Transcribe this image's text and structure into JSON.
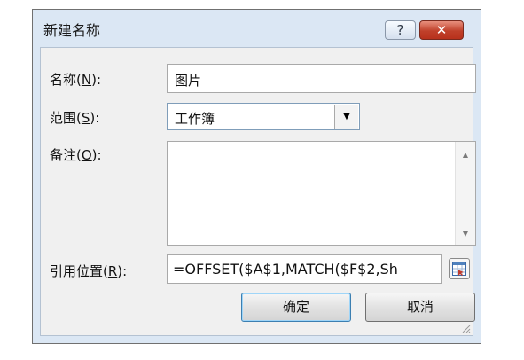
{
  "dialog": {
    "title": "新建名称",
    "help_label": "?",
    "close_label": "✕"
  },
  "form": {
    "name": {
      "label_prefix": "名称(",
      "accel": "N",
      "label_suffix": "):",
      "value": "图片"
    },
    "scope": {
      "label_prefix": "范围(",
      "accel": "S",
      "label_suffix": "):",
      "value": "工作簿",
      "arrow": "▼"
    },
    "comment": {
      "label_prefix": "备注(",
      "accel": "O",
      "label_suffix": "):",
      "value": "",
      "scroll_up": "▲",
      "scroll_down": "▼"
    },
    "refers_to": {
      "label_prefix": "引用位置(",
      "accel": "R",
      "label_suffix": "):",
      "value": "=OFFSET($A$1,MATCH($F$2,Sh"
    }
  },
  "buttons": {
    "ok_label": "确定",
    "cancel_label": "取消"
  },
  "icons": {
    "help": "question-mark-icon",
    "close": "close-icon",
    "dropdown": "chevron-down-icon",
    "range_select": "collapse-dialog-icon",
    "resize": "resize-grip-icon"
  }
}
